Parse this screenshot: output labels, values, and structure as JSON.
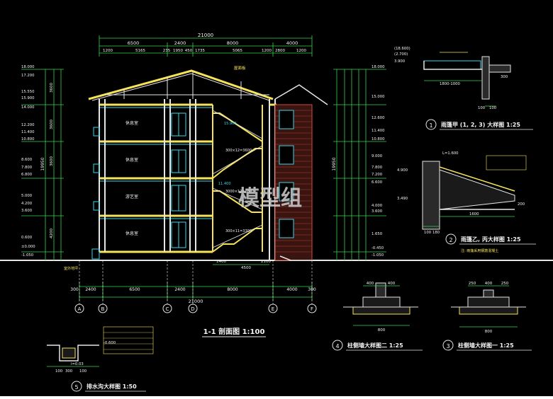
{
  "drawing": {
    "watermark": "模型组",
    "main_title": "1-1 剖面图  1:100",
    "detail_titles": {
      "d1": "雨篷甲 (1, 2, 3) 大样图  1:25",
      "d2": "雨篷乙, 丙大样图  1:25",
      "d3": "柱侧墙大样图一  1:25",
      "d4": "柱侧墙大样图二  1:25",
      "d5": "排水沟大样图  1:50"
    },
    "detail_numbers": {
      "d1": "1",
      "d2": "2",
      "d3": "3",
      "d4": "4",
      "d5": "5"
    },
    "top_total": "21000",
    "top_dims": [
      "6500",
      "2400",
      "8000",
      "4000"
    ],
    "top_sub_dims": [
      "1200",
      "5165",
      "235",
      "1950",
      "450",
      "1735",
      "5065",
      "1200",
      "2800",
      "1200"
    ],
    "bottom_total": "21000",
    "bottom_dims": [
      "300",
      "2400",
      "6500",
      "2400",
      "8000",
      "4000",
      "300"
    ],
    "bottom_sub_dims": [
      "1400",
      "4500",
      "2100"
    ],
    "axes": [
      "A",
      "B",
      "C",
      "D",
      "E",
      "F"
    ],
    "left_elevations": [
      "18.000",
      "17.200",
      "15.550",
      "15.900",
      "14.000",
      "12.200",
      "11.400",
      "10.800",
      "8.600",
      "7.800",
      "6.800",
      "5.000",
      "4.200",
      "3.600",
      "0.600",
      "±0.000",
      "-1.050"
    ],
    "left_total": "19950",
    "left_floor_dims": [
      "3600",
      "3600",
      "3600",
      "4200"
    ],
    "right_elevations": [
      "18.000",
      "15.000",
      "12.600",
      "11.400",
      "10.800",
      "9.000",
      "7.800",
      "7.200",
      "6.600",
      "4.000",
      "3.600",
      "1.650",
      "-0.450",
      "-1.050"
    ],
    "right_total": "19950",
    "room_labels": [
      "休息室",
      "休息室",
      "游艺室",
      "休息室"
    ],
    "notes": {
      "roof": "屋面板",
      "stair_marks": [
        "300×11=3300",
        "300×12=3600",
        "3000×12=3600",
        "2100"
      ],
      "level_marks": [
        "15.900",
        "11.400",
        "0.000"
      ],
      "ground": "室外地坪",
      "note_d2": "注: 雨篷采用钢筋混凝土"
    },
    "d1_labels": [
      "(18.600)",
      "(2.700)",
      "3.900",
      "1800-1000",
      "100",
      "100",
      "300"
    ],
    "d2_labels": [
      "L=1.600",
      "1600",
      "100",
      "180",
      "200",
      "4.900",
      "3.490"
    ],
    "d3_dims": [
      "250",
      "400",
      "250",
      "800"
    ],
    "d4_dims": [
      "400",
      "400",
      "800"
    ],
    "d5_labels": [
      "i=0.03",
      "-0.600",
      "300",
      "100",
      "100"
    ]
  }
}
